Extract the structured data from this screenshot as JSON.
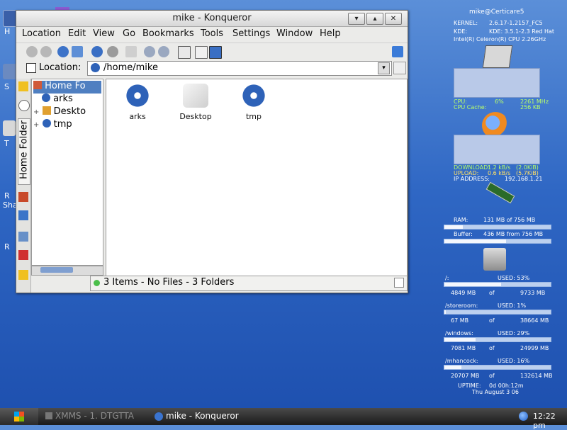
{
  "desktop": {
    "left_labels": [
      "H",
      "S",
      "T",
      "R",
      "Sha",
      "R"
    ]
  },
  "window": {
    "title": "mike - Konqueror",
    "buttons": {
      "minimize": "▾",
      "maximize": "▴",
      "close": "✕"
    },
    "menu": [
      "Location",
      "Edit",
      "View",
      "Go",
      "Bookmarks",
      "Tools",
      "Settings",
      "Window",
      "Help"
    ],
    "location_label": "Location:",
    "location_value": "/home/mike",
    "sidebar_tab_label": "Home Folder",
    "tree": [
      {
        "label": "Home Fo",
        "selected": true
      },
      {
        "label": "arks",
        "selected": false
      },
      {
        "label": "Deskto",
        "selected": false
      },
      {
        "label": "tmp",
        "selected": false
      }
    ],
    "files": [
      {
        "name": "arks",
        "icon": "debian-folder-icon"
      },
      {
        "name": "Desktop",
        "icon": "desktop-folder-icon"
      },
      {
        "name": "tmp",
        "icon": "debian-folder-icon"
      }
    ],
    "status": "3 Items - No Files - 3 Folders"
  },
  "monitor": {
    "host": "mike@Certicare5",
    "kernel_label": "KERNEL:",
    "kernel_value": "2.6.17-1.2157_FC5",
    "kde_label": "KDE:",
    "kde_value": "KDE: 3.5.1-2.3 Red Hat",
    "cpu_model": "Intel(R) Celeron(R) CPU 2.26GHz",
    "cpu_label": "CPU:",
    "cpu_pct": "6%",
    "cpu_mhz": "2261 MHz",
    "cache_label": "CPU Cache:",
    "cache_value": "256 KB",
    "download_label": "DOWNLOAD:",
    "download_value": "1.2 kB/s",
    "download_total": "(2.0KiB)",
    "upload_label": "UPLOAD:",
    "upload_value": "0.6 kB/s",
    "upload_total": "(5.7KiB)",
    "ip_label": "IP ADDRESS:",
    "ip_value": "192.168.1.21",
    "ram_label": "RAM:",
    "ram_value": "131 MB of 756 MB",
    "ram_fraction": 0.17,
    "buffer_label": "Buffer:",
    "buffer_value": "436 MB from 756 MB",
    "buffer_fraction": 0.58,
    "disks": [
      {
        "name": "/:",
        "used": "USED: 53%",
        "used_mb": "4849 MB",
        "of": "of",
        "total": "9733 MB",
        "fraction": 0.53
      },
      {
        "name": "/storeroom:",
        "used": "USED: 1%",
        "used_mb": "67 MB",
        "of": "of",
        "total": "38664 MB",
        "fraction": 0.01
      },
      {
        "name": "/windows:",
        "used": "USED: 29%",
        "used_mb": "7081 MB",
        "of": "of",
        "total": "24999 MB",
        "fraction": 0.29
      },
      {
        "name": "/mhancock:",
        "used": "USED: 16%",
        "used_mb": "20707 MB",
        "of": "of",
        "total": "132614 MB",
        "fraction": 0.16
      }
    ],
    "uptime_label": "UPTIME:",
    "uptime_value": "0d 00h:12m",
    "date": "Thu August 3 06"
  },
  "taskbar": {
    "tasks": [
      "XMMS - 1. DTGTTA",
      "mike - Konqueror"
    ],
    "clock": "12:22 pm"
  }
}
